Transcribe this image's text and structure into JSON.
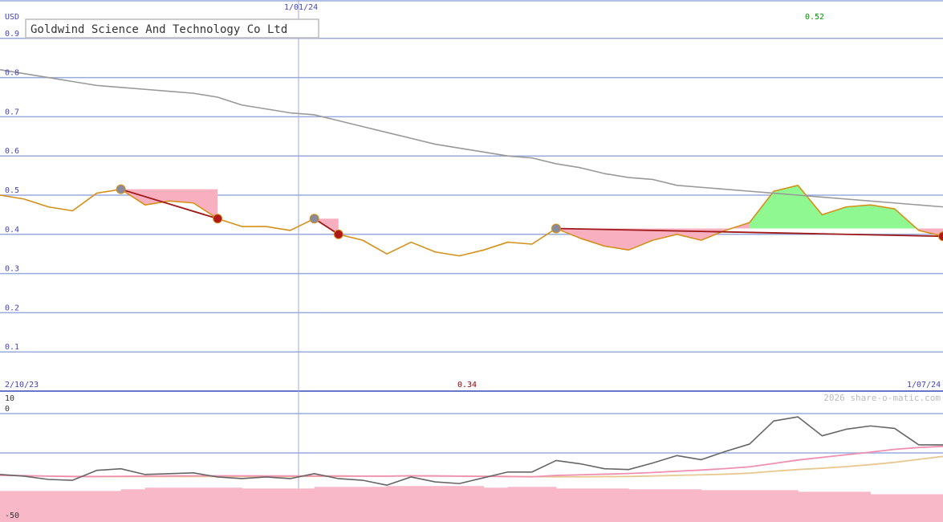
{
  "chart_data": [
    {
      "type": "line",
      "title": "Goldwind Science And Technology Co Ltd",
      "ylabel": "USD",
      "ylim": [
        0,
        0.9
      ],
      "yticks": [
        "0.9",
        "0.8",
        "0.7",
        "0.6",
        "0.5",
        "0.4",
        "0.3",
        "0.2",
        "0.1"
      ],
      "x_top_label": "1/01/24",
      "x_start_label": "2/10/23",
      "x_end_label": "1/07/24",
      "high_label": "0.52",
      "low_label": "0.34",
      "colors": {
        "price": "#d4901a",
        "moving_average": "#999999",
        "trend": "#a01818",
        "loss_fill": "#f8b0c0",
        "gain_fill": "#90f890",
        "grid": "#99aadd",
        "axis_text": "#4444bb",
        "high_text": "#009900",
        "low_text": "#990000"
      },
      "series": [
        {
          "id": "price",
          "values": [
            0.5,
            0.49,
            0.47,
            0.46,
            0.505,
            0.515,
            0.475,
            0.485,
            0.48,
            0.44,
            0.42,
            0.42,
            0.41,
            0.44,
            0.4,
            0.385,
            0.35,
            0.38,
            0.355,
            0.345,
            0.36,
            0.38,
            0.375,
            0.415,
            0.39,
            0.37,
            0.36,
            0.385,
            0.4,
            0.385,
            0.41,
            0.43,
            0.51,
            0.525,
            0.45,
            0.47,
            0.475,
            0.465,
            0.41,
            0.395
          ]
        },
        {
          "id": "moving_average",
          "values": [
            0.82,
            0.81,
            0.8,
            0.79,
            0.78,
            0.775,
            0.77,
            0.765,
            0.76,
            0.75,
            0.73,
            0.72,
            0.71,
            0.705,
            0.69,
            0.675,
            0.66,
            0.645,
            0.63,
            0.62,
            0.61,
            0.6,
            0.595,
            0.58,
            0.57,
            0.555,
            0.545,
            0.54,
            0.525,
            0.52,
            0.515,
            0.51,
            0.505,
            0.5,
            0.495,
            0.49,
            0.485,
            0.48,
            0.475,
            0.47
          ]
        }
      ],
      "markers": [
        {
          "index": 5,
          "kind": "peak"
        },
        {
          "index": 9,
          "kind": "trough"
        },
        {
          "index": 13,
          "kind": "peak"
        },
        {
          "index": 14,
          "kind": "trough"
        },
        {
          "index": 23,
          "kind": "peak"
        },
        {
          "index": 39,
          "kind": "trough"
        }
      ],
      "trend_lines": [
        {
          "from": 5,
          "to": 9
        },
        {
          "from": 13,
          "to": 14
        },
        {
          "from": 23,
          "to": 39
        }
      ],
      "shaded_regions": [
        {
          "from": 5,
          "to": 9,
          "level": 0.515,
          "kind": "loss"
        },
        {
          "from": 13,
          "to": 14,
          "level": 0.44,
          "kind": "loss"
        },
        {
          "from": 23,
          "to": 31,
          "level": 0.415,
          "kind": "loss"
        },
        {
          "from": 31,
          "to": 38,
          "level": 0.415,
          "kind": "gain"
        },
        {
          "from": 38,
          "to": 39,
          "level": 0.415,
          "kind": "loss"
        }
      ]
    },
    {
      "type": "line",
      "yticks": [
        "10",
        "0",
        "-50"
      ],
      "ylim": [
        -50,
        10
      ],
      "watermark": "2026 share-o-matic.com",
      "colors": {
        "momentum": "#666666",
        "pink_ma": "#f090b0",
        "tan_ma": "#e8c890",
        "histogram": "#f8b8c8"
      },
      "series": [
        {
          "id": "momentum",
          "values": [
            -37,
            -38,
            -40,
            -40.5,
            -34.5,
            -33.5,
            -37,
            -36.5,
            -36,
            -38.5,
            -39.5,
            -38.5,
            -39.5,
            -36.5,
            -39.5,
            -40.5,
            -43.5,
            -38.5,
            -41.5,
            -42.5,
            -39,
            -35.5,
            -35.5,
            -28.5,
            -30.5,
            -33.5,
            -34,
            -30,
            -25.5,
            -28,
            -23,
            -18.5,
            -4.5,
            -2,
            -13.5,
            -9.5,
            -7.5,
            -9,
            -19,
            -19
          ]
        },
        {
          "id": "pink_ma",
          "values": [
            -37.5,
            -37.7,
            -38.0,
            -38.2,
            -38.2,
            -38.1,
            -38.0,
            -37.9,
            -37.8,
            -37.8,
            -37.8,
            -37.9,
            -37.9,
            -37.9,
            -37.9,
            -38.0,
            -38.0,
            -37.8,
            -37.9,
            -38.0,
            -38.1,
            -38.2,
            -38.4,
            -37.6,
            -37.2,
            -36.8,
            -36.4,
            -35.8,
            -35.0,
            -34.3,
            -33.4,
            -32.3,
            -30.3,
            -28.2,
            -26.6,
            -25.0,
            -23.4,
            -21.7,
            -20.6,
            -19.9
          ]
        },
        {
          "id": "tan_ma",
          "values": [
            -37.5,
            -37.8,
            -38.0,
            -38.2,
            -38.3,
            -38.3,
            -38.3,
            -38.2,
            -38.2,
            -38.2,
            -38.2,
            -38.2,
            -38.2,
            -38.1,
            -38.1,
            -38.0,
            -38.0,
            -37.9,
            -37.9,
            -38.0,
            -38.1,
            -38.2,
            -38.3,
            -38.4,
            -38.4,
            -38.3,
            -38.2,
            -37.9,
            -37.5,
            -37.2,
            -36.8,
            -36.2,
            -35.0,
            -34.0,
            -33.2,
            -32.2,
            -31.0,
            -29.6,
            -27.8,
            -26.0
          ]
        }
      ],
      "histogram": [
        {
          "from": 0,
          "to": 5,
          "value": -47
        },
        {
          "from": 5,
          "to": 6,
          "value": -46
        },
        {
          "from": 6,
          "to": 10,
          "value": -45
        },
        {
          "from": 10,
          "to": 13,
          "value": -45.5
        },
        {
          "from": 13,
          "to": 16,
          "value": -44.5
        },
        {
          "from": 16,
          "to": 20,
          "value": -44
        },
        {
          "from": 20,
          "to": 21,
          "value": -45
        },
        {
          "from": 21,
          "to": 23,
          "value": -44.5
        },
        {
          "from": 23,
          "to": 26,
          "value": -45.5
        },
        {
          "from": 26,
          "to": 29,
          "value": -46
        },
        {
          "from": 29,
          "to": 33,
          "value": -46.5
        },
        {
          "from": 33,
          "to": 36,
          "value": -47.5
        },
        {
          "from": 36,
          "to": 40,
          "value": -49
        }
      ]
    }
  ]
}
